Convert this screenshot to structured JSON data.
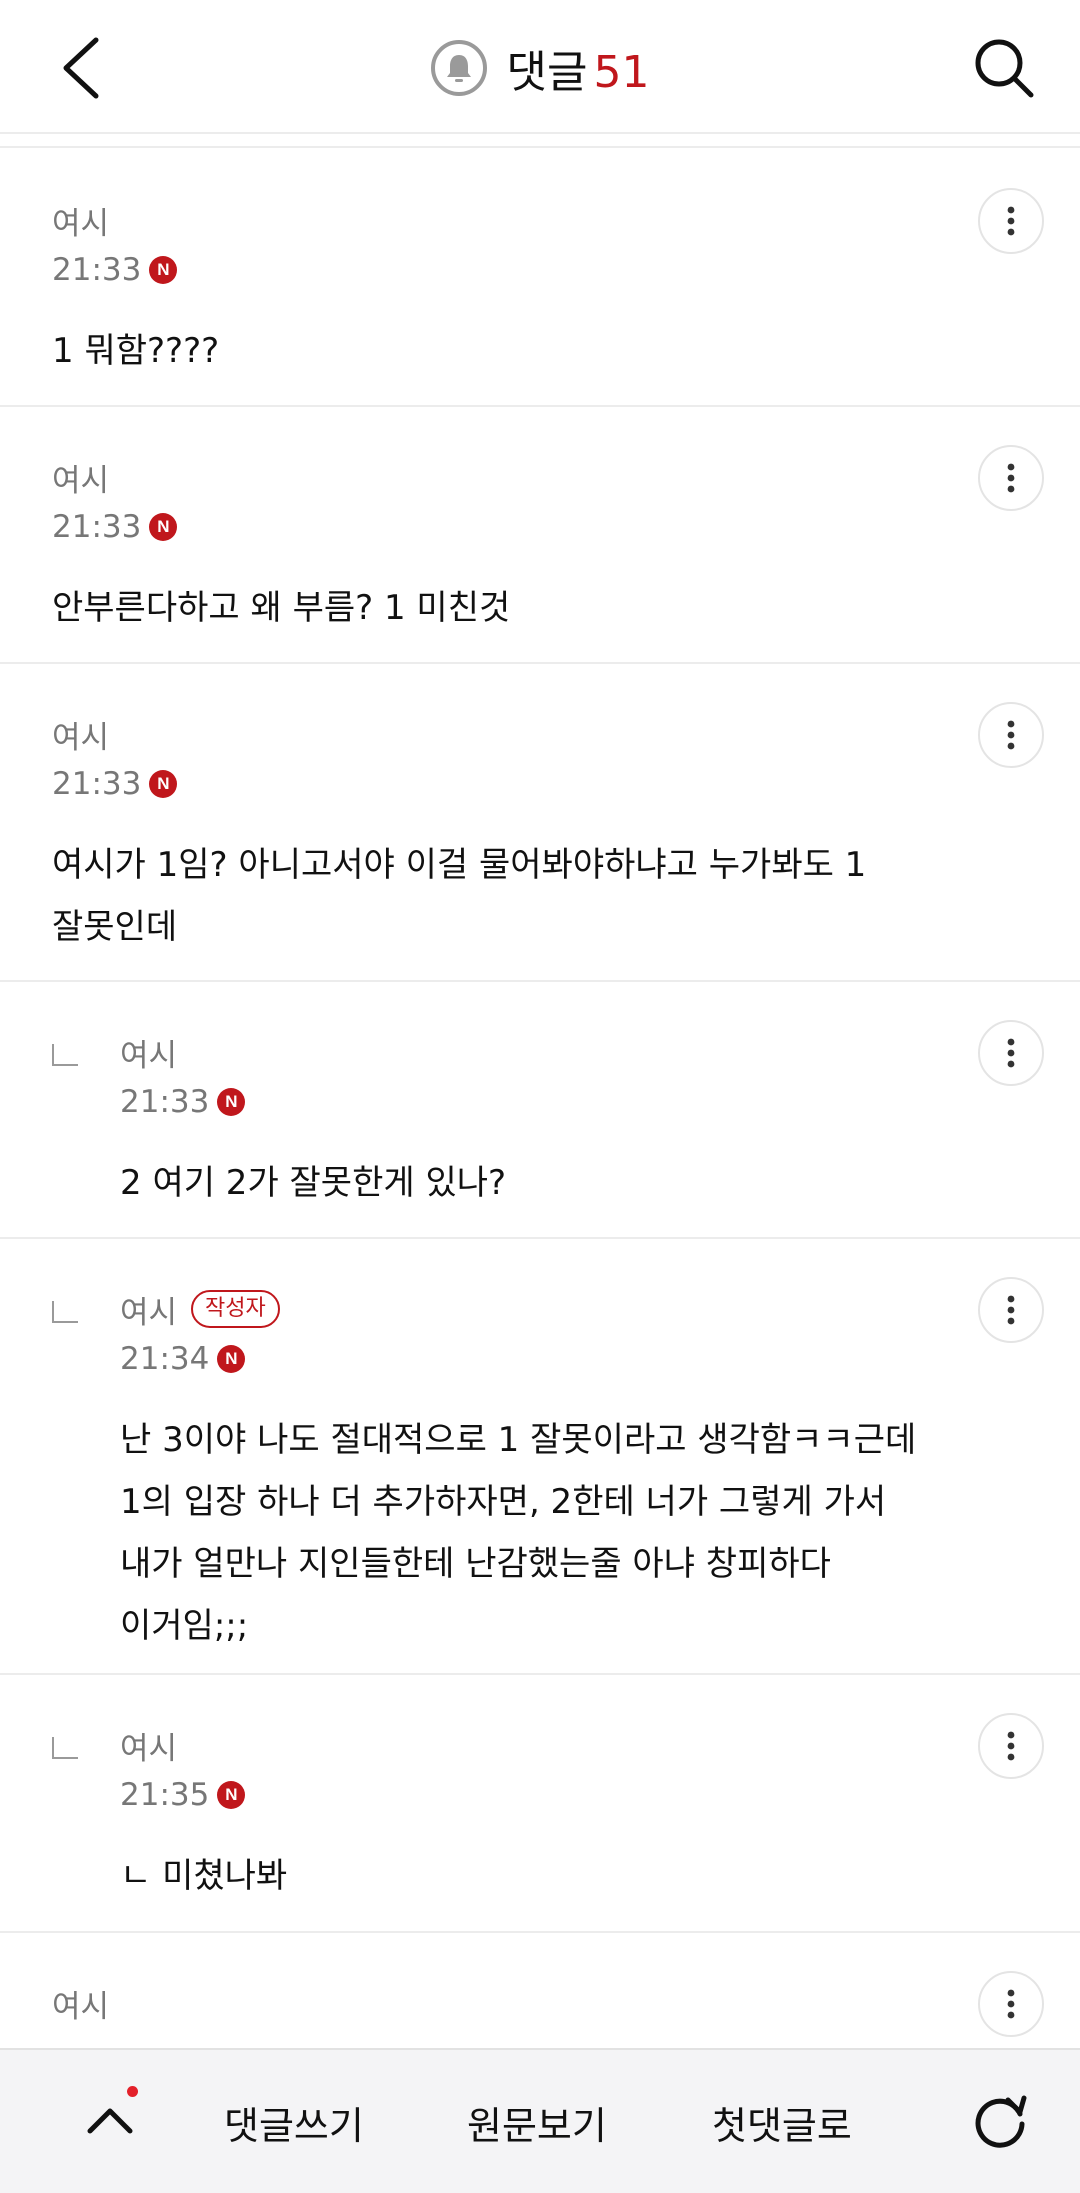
{
  "header": {
    "title": "댓글",
    "count": "51",
    "back_icon": "chevron-left-icon",
    "bell_icon": "bell-icon",
    "search_icon": "search-icon"
  },
  "comments": [
    {
      "nick": "여시",
      "author_badge": "",
      "time": "21:33",
      "new_badge": "N",
      "text": "1 뭐함????",
      "reply": false
    },
    {
      "nick": "여시",
      "author_badge": "",
      "time": "21:33",
      "new_badge": "N",
      "text": "안부른다하고 왜 부름? 1 미친것",
      "reply": false
    },
    {
      "nick": "여시",
      "author_badge": "",
      "time": "21:33",
      "new_badge": "N",
      "text": "여시가 1임? 아니고서야 이걸 물어봐야하냐고 누가봐도 1\n잘못인데",
      "reply": false
    },
    {
      "nick": "여시",
      "author_badge": "",
      "time": "21:33",
      "new_badge": "N",
      "text": "2 여기 2가 잘못한게 있나?",
      "reply": true
    },
    {
      "nick": "여시",
      "author_badge": "작성자",
      "time": "21:34",
      "new_badge": "N",
      "text": "난 3이야 나도 절대적으로 1 잘못이라고 생각함ㅋㅋ근데\n1의 입장 하나 더 추가하자면, 2한테 너가 그렇게 가서\n내가 얼만나 지인들한테 난감했는줄 아냐 창피하다\n이거임;;;",
      "reply": true
    },
    {
      "nick": "여시",
      "author_badge": "",
      "time": "21:35",
      "new_badge": "N",
      "text": "ㄴ 미쳤나봐",
      "reply": true
    },
    {
      "nick": "여시",
      "author_badge": "",
      "time": "",
      "new_badge": "",
      "text": "",
      "reply": false
    }
  ],
  "bottom_bar": {
    "write_comment": "댓글쓰기",
    "view_original": "원문보기",
    "first_comment": "첫댓글로",
    "up_icon": "chevron-up-icon",
    "refresh_icon": "refresh-icon"
  },
  "colors": {
    "accent": "#c0171c",
    "muted_text": "#777777",
    "divider": "#ececec"
  }
}
